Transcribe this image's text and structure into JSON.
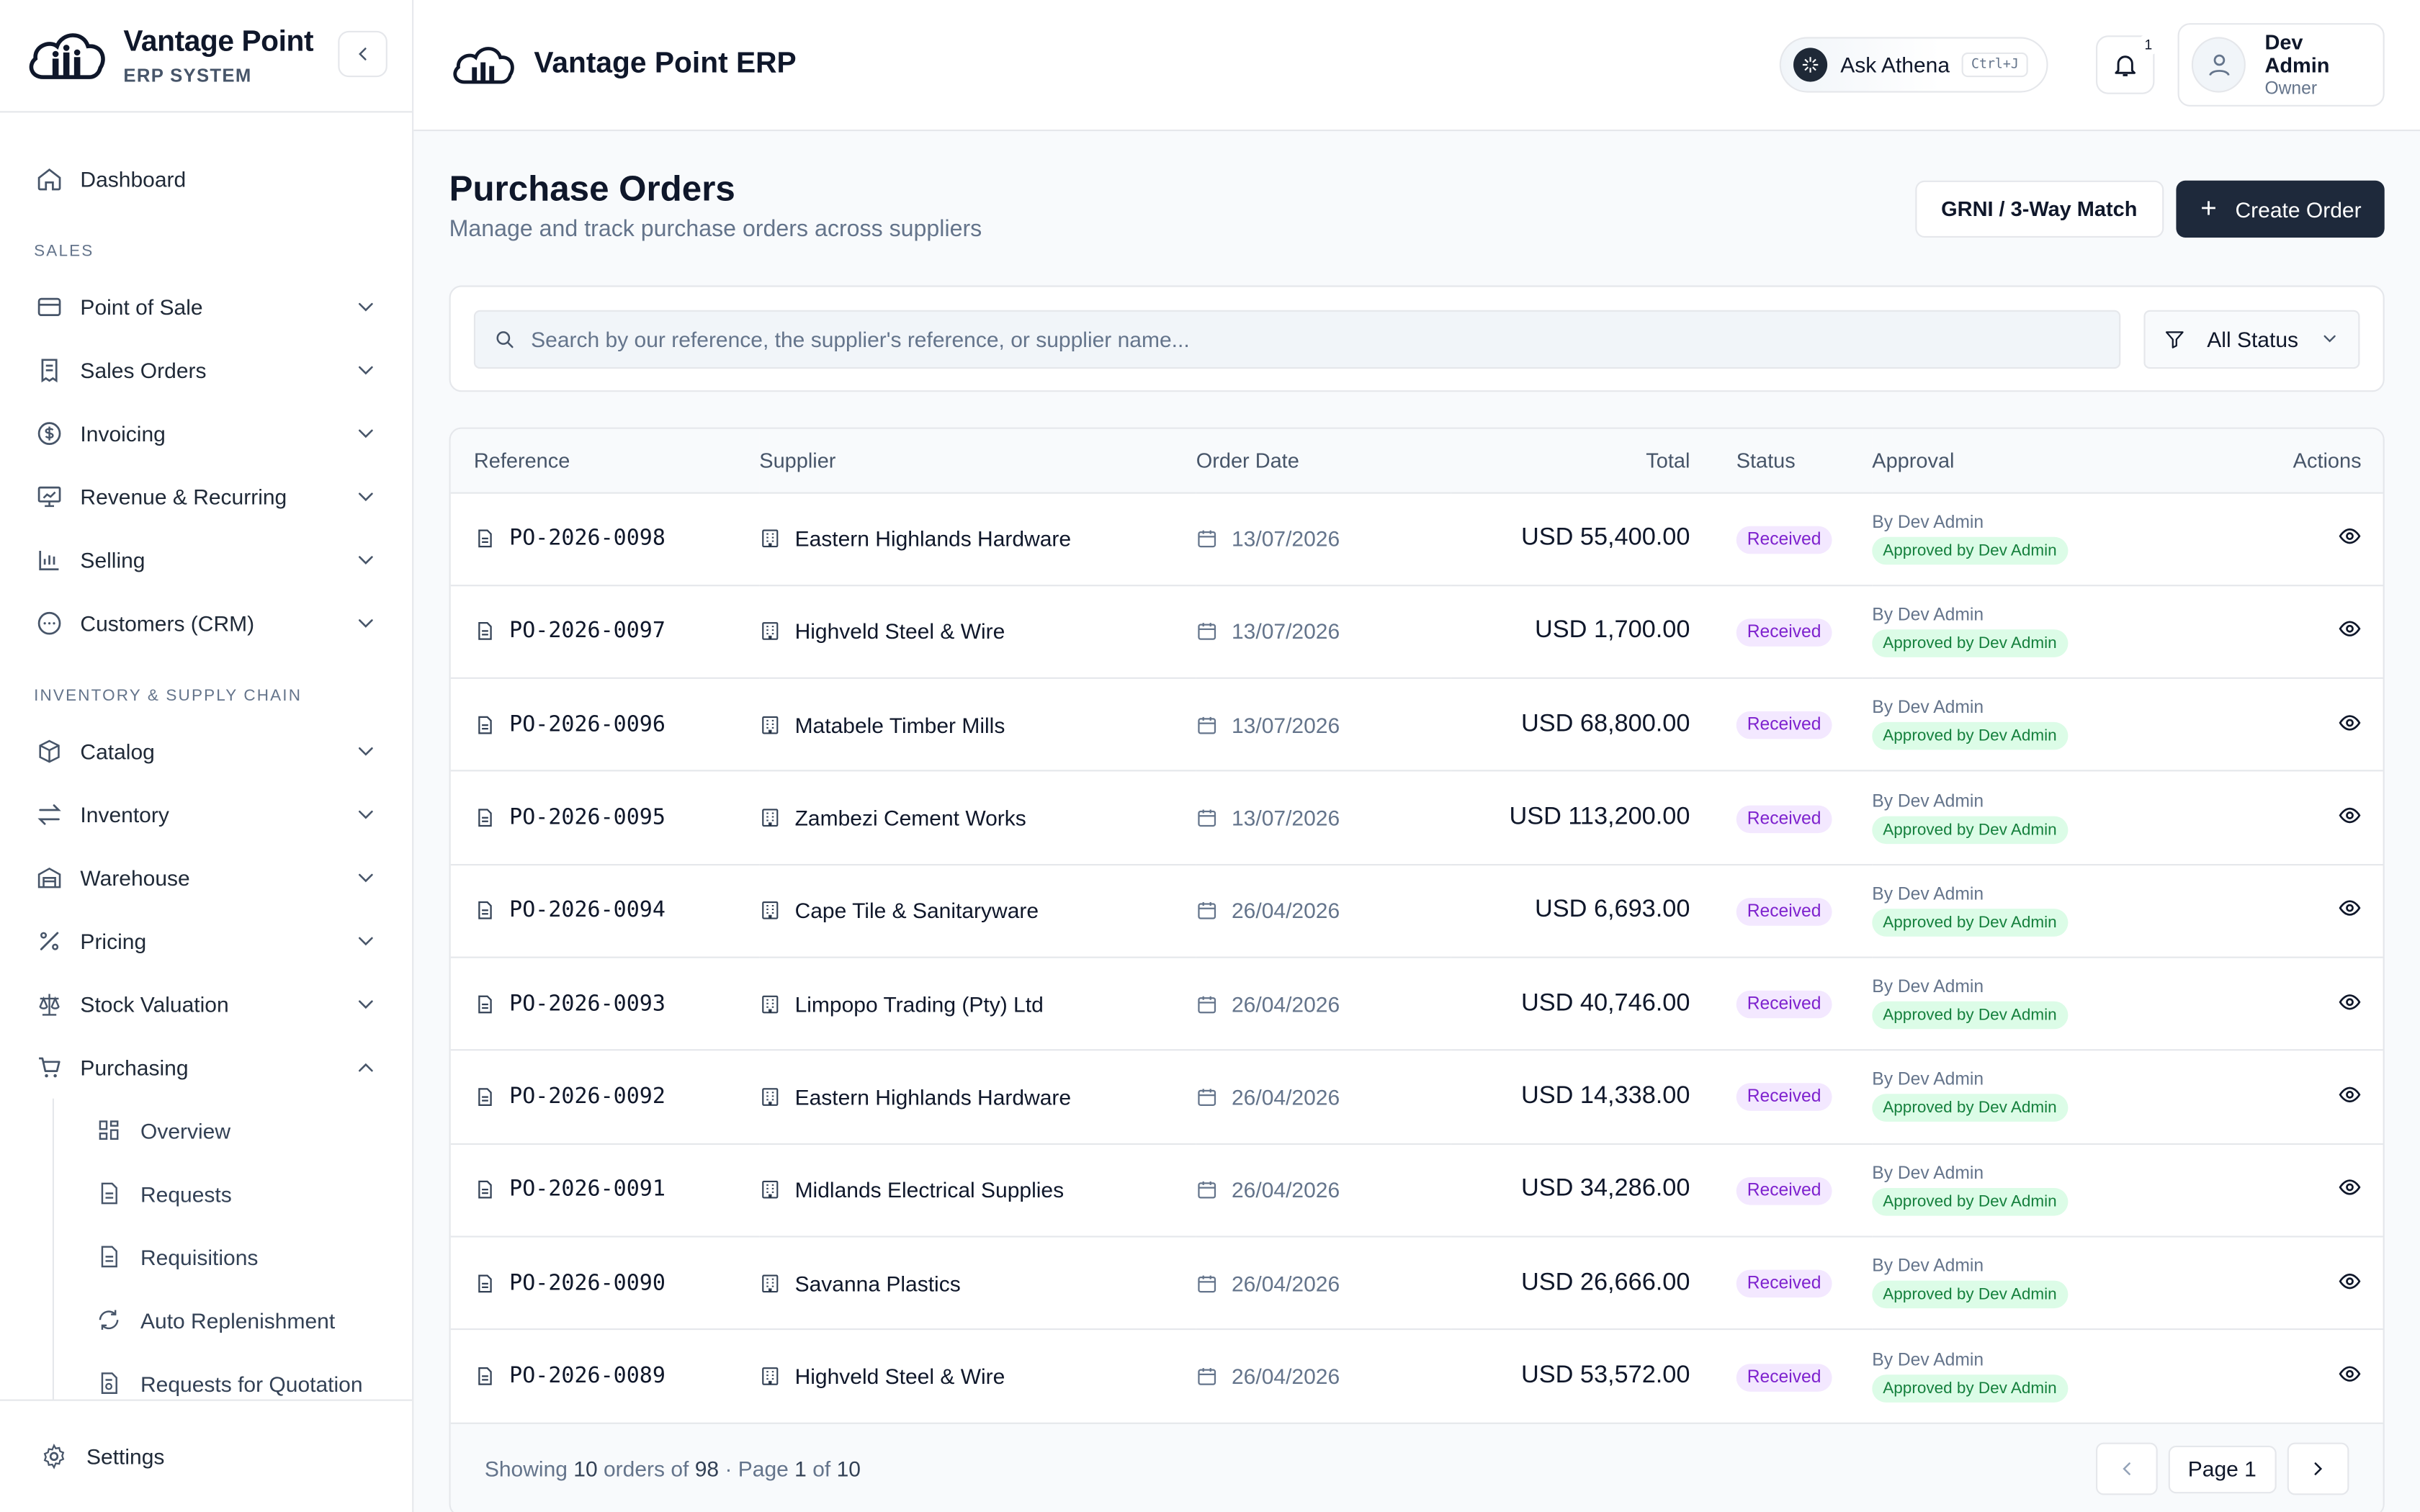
{
  "brand": {
    "title": "Vantage Point",
    "subtitle": "ERP SYSTEM"
  },
  "topbar": {
    "title": "Vantage Point ERP",
    "ask_label": "Ask Athena",
    "ask_shortcut": "Ctrl+J",
    "notifications_count": "1",
    "user_name": "Dev Admin",
    "user_role": "Owner"
  },
  "sidebar": {
    "dashboard": "Dashboard",
    "section_sales": "SALES",
    "sales_items": [
      "Point of Sale",
      "Sales Orders",
      "Invoicing",
      "Revenue & Recurring",
      "Selling",
      "Customers (CRM)"
    ],
    "section_inventory": "INVENTORY & SUPPLY CHAIN",
    "inventory_items": [
      "Catalog",
      "Inventory",
      "Warehouse",
      "Pricing",
      "Stock Valuation",
      "Purchasing"
    ],
    "purchasing_sub": [
      "Overview",
      "Requests",
      "Requisitions",
      "Auto Replenishment",
      "Requests for Quotation"
    ],
    "settings": "Settings"
  },
  "page": {
    "title": "Purchase Orders",
    "subtitle": "Manage and track purchase orders across suppliers",
    "grni_button": "GRNI / 3-Way Match",
    "create_button": "Create Order"
  },
  "search": {
    "placeholder": "Search by our reference, the supplier's reference, or supplier name...",
    "status_filter": "All Status"
  },
  "table": {
    "headers": [
      "Reference",
      "Supplier",
      "Order Date",
      "Total",
      "Status",
      "Approval",
      "Actions"
    ],
    "rows": [
      {
        "ref": "PO-2026-0098",
        "supplier": "Eastern Highlands Hardware",
        "date": "13/07/2026",
        "total": "USD 55,400.00",
        "status": "Received",
        "by": "By Dev Admin",
        "approval": "Approved by Dev Admin"
      },
      {
        "ref": "PO-2026-0097",
        "supplier": "Highveld Steel & Wire",
        "date": "13/07/2026",
        "total": "USD 1,700.00",
        "status": "Received",
        "by": "By Dev Admin",
        "approval": "Approved by Dev Admin"
      },
      {
        "ref": "PO-2026-0096",
        "supplier": "Matabele Timber Mills",
        "date": "13/07/2026",
        "total": "USD 68,800.00",
        "status": "Received",
        "by": "By Dev Admin",
        "approval": "Approved by Dev Admin"
      },
      {
        "ref": "PO-2026-0095",
        "supplier": "Zambezi Cement Works",
        "date": "13/07/2026",
        "total": "USD 113,200.00",
        "status": "Received",
        "by": "By Dev Admin",
        "approval": "Approved by Dev Admin"
      },
      {
        "ref": "PO-2026-0094",
        "supplier": "Cape Tile & Sanitaryware",
        "date": "26/04/2026",
        "total": "USD 6,693.00",
        "status": "Received",
        "by": "By Dev Admin",
        "approval": "Approved by Dev Admin"
      },
      {
        "ref": "PO-2026-0093",
        "supplier": "Limpopo Trading (Pty) Ltd",
        "date": "26/04/2026",
        "total": "USD 40,746.00",
        "status": "Received",
        "by": "By Dev Admin",
        "approval": "Approved by Dev Admin"
      },
      {
        "ref": "PO-2026-0092",
        "supplier": "Eastern Highlands Hardware",
        "date": "26/04/2026",
        "total": "USD 14,338.00",
        "status": "Received",
        "by": "By Dev Admin",
        "approval": "Approved by Dev Admin"
      },
      {
        "ref": "PO-2026-0091",
        "supplier": "Midlands Electrical Supplies",
        "date": "26/04/2026",
        "total": "USD 34,286.00",
        "status": "Received",
        "by": "By Dev Admin",
        "approval": "Approved by Dev Admin"
      },
      {
        "ref": "PO-2026-0090",
        "supplier": "Savanna Plastics",
        "date": "26/04/2026",
        "total": "USD 26,666.00",
        "status": "Received",
        "by": "By Dev Admin",
        "approval": "Approved by Dev Admin"
      },
      {
        "ref": "PO-2026-0089",
        "supplier": "Highveld Steel & Wire",
        "date": "26/04/2026",
        "total": "USD 53,572.00",
        "status": "Received",
        "by": "By Dev Admin",
        "approval": "Approved by Dev Admin"
      }
    ]
  },
  "footer": {
    "showing": "Showing",
    "shown_count": "10",
    "orders_of": "orders of",
    "total_count": "98",
    "page_word": "· Page",
    "page_current": "1",
    "of_word": "of",
    "page_total": "10",
    "page_label": "Page 1"
  },
  "colors": {
    "primary": "#1e293b",
    "status_received_bg": "#f3e8ff",
    "status_received_fg": "#7e22ce",
    "approved_bg": "#dcfce7",
    "approved_fg": "#15803d"
  }
}
